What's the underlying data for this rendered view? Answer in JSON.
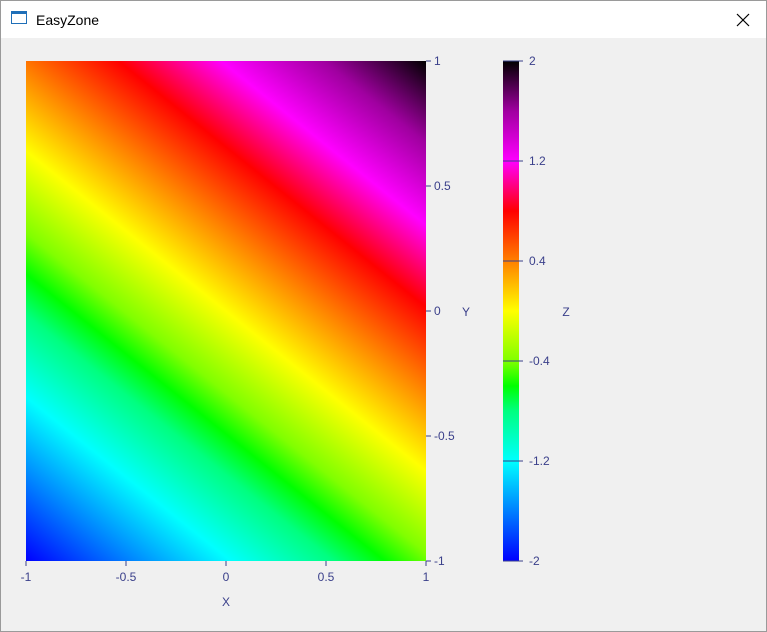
{
  "window": {
    "title": "EasyZone",
    "app_icon": "window-icon",
    "close_icon": "close-icon"
  },
  "colors": {
    "axis_text": "#3a3f8a",
    "tick": "#3a3f8a",
    "background": "#f0f0f0"
  },
  "chart_data": {
    "type": "heatmap",
    "function": "z = x + y",
    "x": {
      "label": "X",
      "range": [
        -1,
        1
      ],
      "ticks": [
        "-1",
        "-0.5",
        "0",
        "0.5",
        "1"
      ]
    },
    "y": {
      "label": "Y",
      "range": [
        -1,
        1
      ],
      "ticks": [
        "-1",
        "-0.5",
        "0",
        "0.5",
        "1"
      ]
    },
    "z": {
      "label": "Z",
      "range": [
        -2,
        2
      ],
      "ticks": [
        "-2",
        "-1.2",
        "-0.4",
        "0.4",
        "1.2",
        "2"
      ]
    },
    "colormap": [
      {
        "value": -2.0,
        "color": "#0000ff"
      },
      {
        "value": -1.6,
        "color": "#0080ff"
      },
      {
        "value": -1.2,
        "color": "#00ffff"
      },
      {
        "value": -0.8,
        "color": "#00ff80"
      },
      {
        "value": -0.6,
        "color": "#00ff00"
      },
      {
        "value": -0.4,
        "color": "#80ff00"
      },
      {
        "value": 0.0,
        "color": "#ffff00"
      },
      {
        "value": 0.4,
        "color": "#ff8000"
      },
      {
        "value": 0.8,
        "color": "#ff0000"
      },
      {
        "value": 1.2,
        "color": "#ff00ff"
      },
      {
        "value": 1.6,
        "color": "#a000a0"
      },
      {
        "value": 2.0,
        "color": "#000000"
      }
    ],
    "grid": false,
    "legend": "colorbar-right"
  }
}
